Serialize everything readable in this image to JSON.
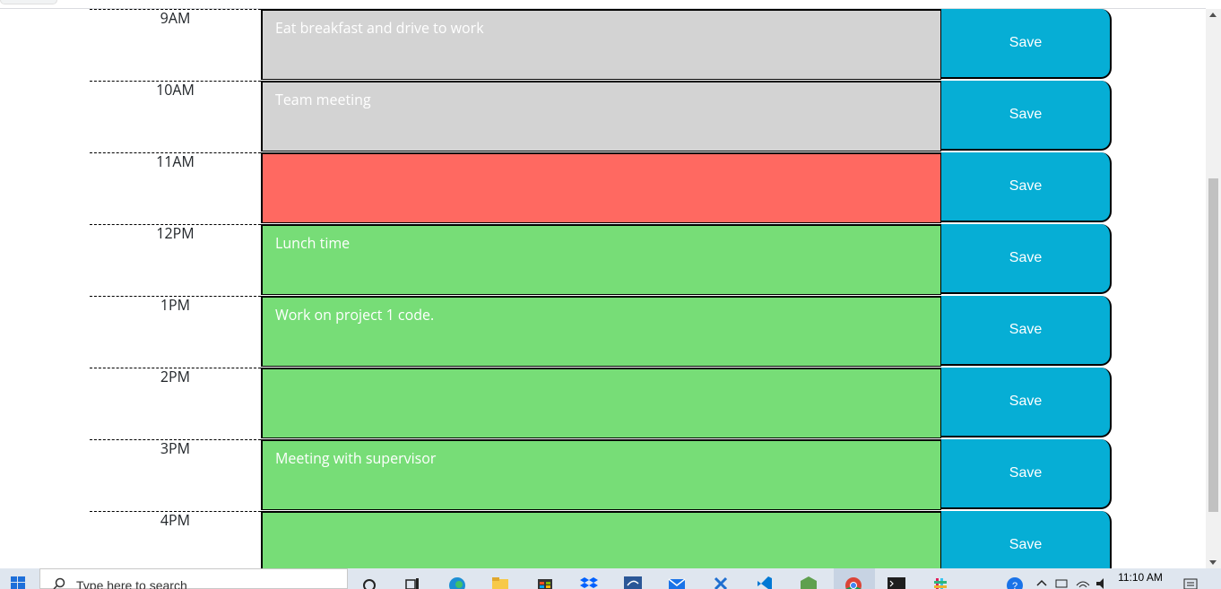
{
  "scheduler": {
    "rows": [
      {
        "hour": "9AM",
        "text": "Eat breakfast and drive to work",
        "state": "past",
        "save_label": "Save"
      },
      {
        "hour": "10AM",
        "text": "Team meeting",
        "state": "past",
        "save_label": "Save"
      },
      {
        "hour": "11AM",
        "text": "",
        "state": "present",
        "save_label": "Save"
      },
      {
        "hour": "12PM",
        "text": "Lunch time",
        "state": "future",
        "save_label": "Save"
      },
      {
        "hour": "1PM",
        "text": "Work on project 1 code.",
        "state": "future",
        "save_label": "Save"
      },
      {
        "hour": "2PM",
        "text": "",
        "state": "future",
        "save_label": "Save"
      },
      {
        "hour": "3PM",
        "text": "Meeting with supervisor",
        "state": "future",
        "save_label": "Save"
      },
      {
        "hour": "4PM",
        "text": "",
        "state": "future",
        "save_label": "Save"
      }
    ],
    "colors": {
      "past": "#d3d3d3",
      "present": "#ff6961",
      "future": "#77dd77",
      "save": "#06aed5"
    }
  },
  "taskbar": {
    "search_placeholder": "Type here to search",
    "clock_time": "11:10 AM",
    "icons": [
      "windows-start-icon",
      "cortana-icon",
      "task-view-icon",
      "edge-icon",
      "file-explorer-icon",
      "store-icon",
      "dropbox-icon",
      "mysql-workbench-icon",
      "mail-icon",
      "visual-studio-icon",
      "vscode-icon",
      "node-icon",
      "chrome-icon",
      "terminal-icon",
      "slack-icon"
    ],
    "tray_icons": [
      "help-icon",
      "chevron-up-icon",
      "network-icon",
      "wifi-icon",
      "volume-icon",
      "notification-icon"
    ]
  }
}
